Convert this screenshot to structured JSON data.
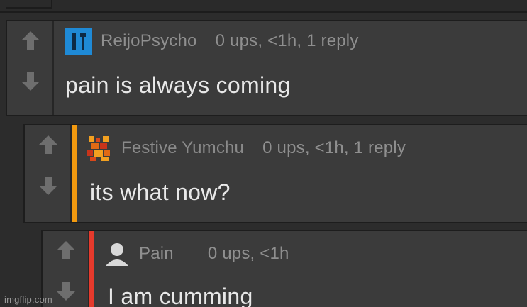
{
  "comments": [
    {
      "username": "ReijoPsycho",
      "meta": "0 ups, <1h, 1 reply",
      "body": "pain is always coming",
      "avatar_icon": "blue-square-avatar-icon",
      "accent": null
    },
    {
      "username": "Festive Yumchu",
      "meta": "0 ups, <1h, 1 reply",
      "body": "its what now?",
      "avatar_icon": "pixel-art-avatar-icon",
      "accent": "#f29a10"
    },
    {
      "username": "Pain",
      "meta": "0 ups, <1h",
      "body": "I am cumming",
      "avatar_icon": "default-user-avatar-icon",
      "accent": "#e53a2c"
    }
  ],
  "colors": {
    "background": "#2c2c2c",
    "card": "#3b3b3b",
    "border": "#1d1d1d",
    "meta_text": "#8f8f8f",
    "body_text": "#e8e8e8",
    "username_2_tint": "#3f9e86",
    "accent_orange": "#f29a10",
    "accent_red": "#e53a2c",
    "avatar_blue": "#1f8ad6"
  },
  "watermark": "imgflip.com"
}
